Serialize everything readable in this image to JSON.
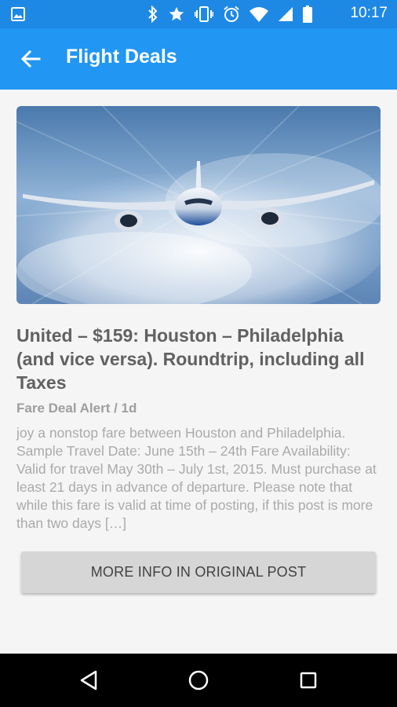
{
  "status_bar": {
    "time": "10:17",
    "icons": [
      "image-icon",
      "bluetooth-icon",
      "star-icon",
      "vibrate-icon",
      "alarm-icon",
      "wifi-icon",
      "signal-icon",
      "battery-icon"
    ]
  },
  "app_bar": {
    "title": "Flight Deals",
    "background": "#2196f3"
  },
  "post": {
    "headline": "United – $159: Houston – Philadelphia (and vice versa). Roundtrip, including all Taxes",
    "meta": "Fare Deal Alert / 1d",
    "excerpt": "joy a nonstop fare between Houston and Philadelphia. Sample Travel Date: June 15th – 24th Fare Availability: Valid for travel May 30th – July 1st, 2015. Must purchase at least 21 days in advance of departure. Please note that while this fare is valid at time of posting, if this post is more than two days […]",
    "button_label": "MORE INFO IN ORIGINAL POST"
  },
  "nav_bar": {
    "icons": [
      "back-triangle-icon",
      "home-circle-icon",
      "recents-square-icon"
    ]
  }
}
